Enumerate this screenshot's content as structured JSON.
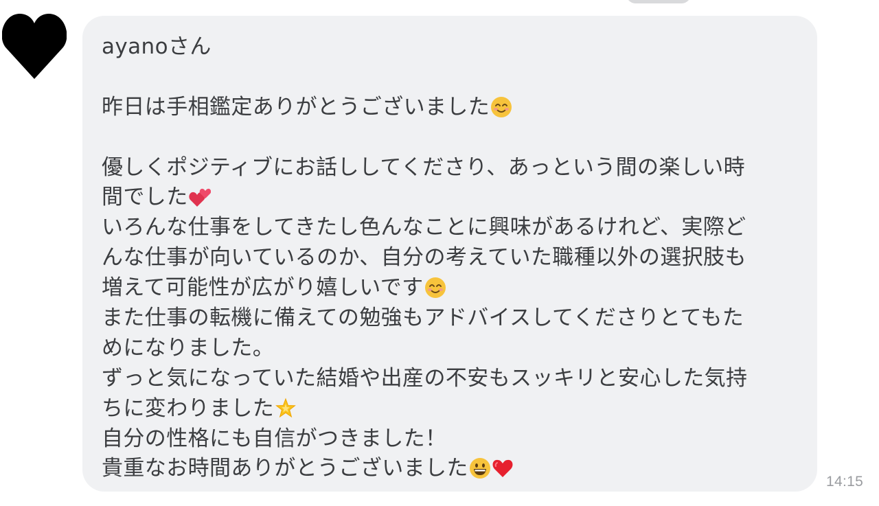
{
  "chat": {
    "sender_avatar": "heart-avatar",
    "message_lines": {
      "greeting": "ayanoさん",
      "l1": "昨日は手相鑑定ありがとうございました",
      "l2": "優しくポジティブにお話ししてくださり、あっという間の楽しい時",
      "l3": "間でした",
      "l4": "いろんな仕事をしてきたし色んなことに興味があるけれど、実際ど",
      "l5": "んな仕事が向いているのか、自分の考えていた職種以外の選択肢も",
      "l6": "増えて可能性が広がり嬉しいです",
      "l7": "また仕事の転機に備えての勉強もアドバイスしてくださりとてもた",
      "l8": "めになりました。",
      "l9": "ずっと気になっていた結婚や出産の不安もスッキリと安心した気持",
      "l10": "ちに変わりました",
      "l11": "自分の性格にも自信がつきました！",
      "l12": "貴重なお時間ありがとうございました"
    },
    "emojis": {
      "smile": "smiling-face-emoji",
      "hearts": "two-hearts-emoji",
      "star": "glowing-star-emoji",
      "grin": "grinning-face-emoji",
      "heart": "red-heart-emoji"
    },
    "timestamp": "14:15"
  }
}
